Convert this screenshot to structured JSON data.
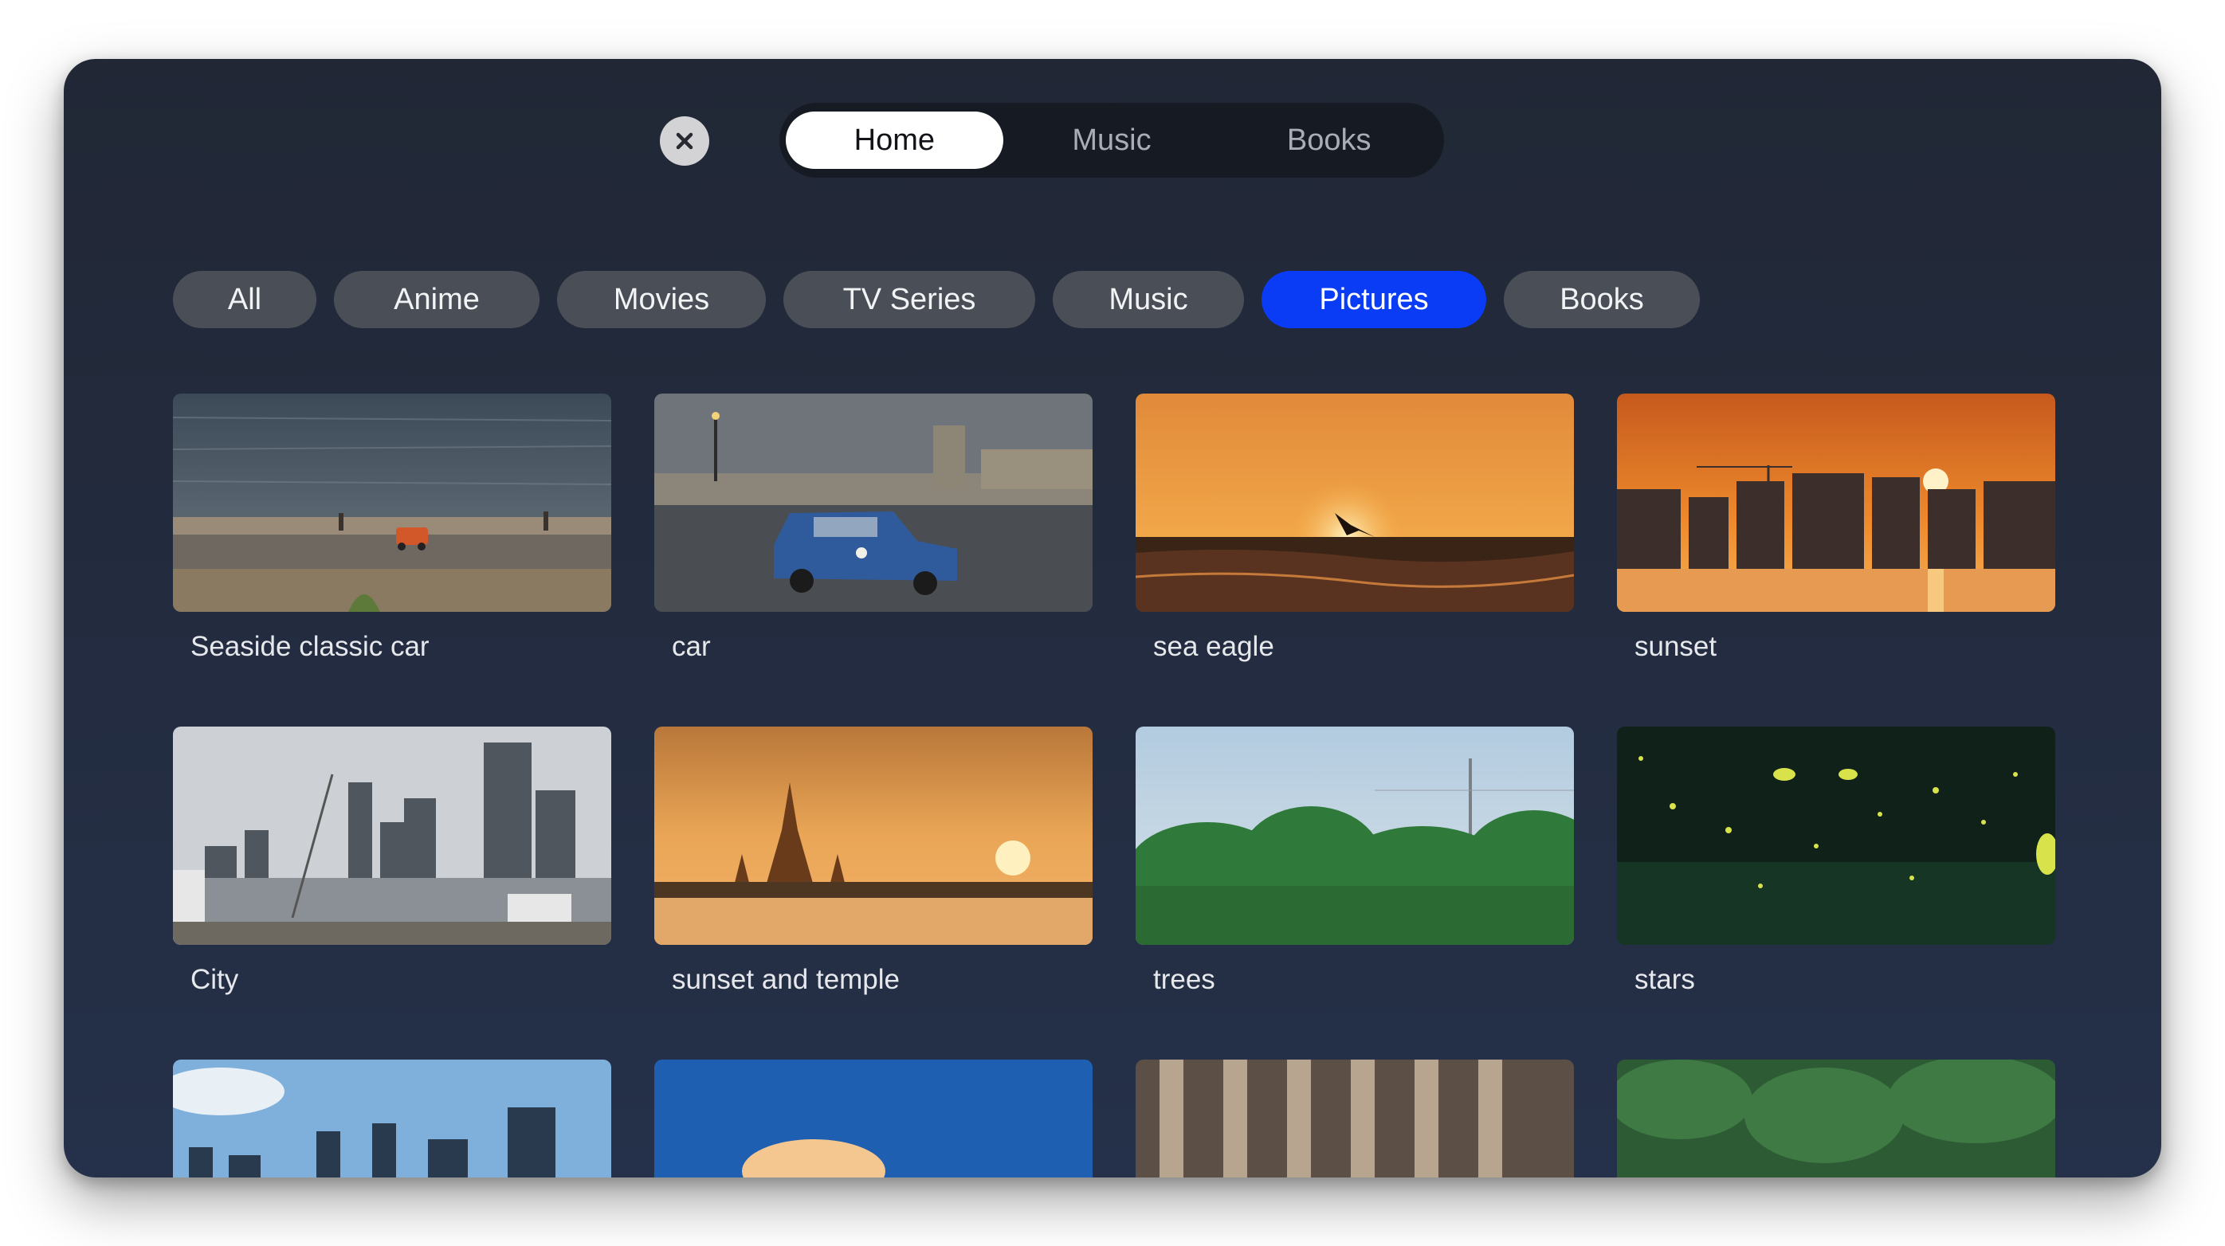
{
  "top_tabs": [
    {
      "label": "Home",
      "active": true
    },
    {
      "label": "Music",
      "active": false
    },
    {
      "label": "Books",
      "active": false
    }
  ],
  "close_icon": "close-icon",
  "categories": [
    {
      "label": "All",
      "active": false
    },
    {
      "label": "Anime",
      "active": false
    },
    {
      "label": "Movies",
      "active": false
    },
    {
      "label": "TV Series",
      "active": false
    },
    {
      "label": "Music",
      "active": false
    },
    {
      "label": "Pictures",
      "active": true
    },
    {
      "label": "Books",
      "active": false
    }
  ],
  "colors": {
    "accent": "#0a3cf5",
    "background": "#222a3b",
    "chip": "#4a4e57"
  },
  "pictures": [
    {
      "title": "Seaside classic car"
    },
    {
      "title": "car"
    },
    {
      "title": "sea eagle"
    },
    {
      "title": "sunset"
    },
    {
      "title": "City"
    },
    {
      "title": "sunset and temple"
    },
    {
      "title": "trees"
    },
    {
      "title": "stars"
    },
    {
      "title": ""
    },
    {
      "title": ""
    },
    {
      "title": ""
    },
    {
      "title": ""
    }
  ]
}
